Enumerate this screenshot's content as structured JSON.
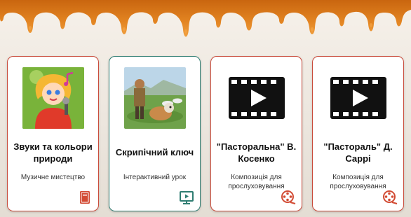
{
  "colors": {
    "honey": "#e07e1d",
    "honey_dark": "#c9650f",
    "card_border_red": "#c94a3a",
    "card_border_teal": "#2f7d72",
    "icon_red": "#d24b34"
  },
  "cards": [
    {
      "title": "Звуки та кольори природи",
      "subtitle": "Музичне мистецтво",
      "thumb_icon": "singing-girl-illustration",
      "corner_icon": "book-icon"
    },
    {
      "title": "Скрипічний ключ",
      "subtitle": "Інтерактивний урок",
      "thumb_icon": "shepherd-boy-dog-photo",
      "corner_icon": "presentation-icon"
    },
    {
      "title": "\"Пасторальна\" В. Косенко",
      "subtitle": "Композиція для прослуховування",
      "thumb_icon": "video-film-icon",
      "corner_icon": "film-reel-icon"
    },
    {
      "title": "\"Пастораль\" Д. Саррі",
      "subtitle": "Композиція для прослуховування",
      "thumb_icon": "video-film-icon",
      "corner_icon": "film-reel-icon"
    }
  ]
}
